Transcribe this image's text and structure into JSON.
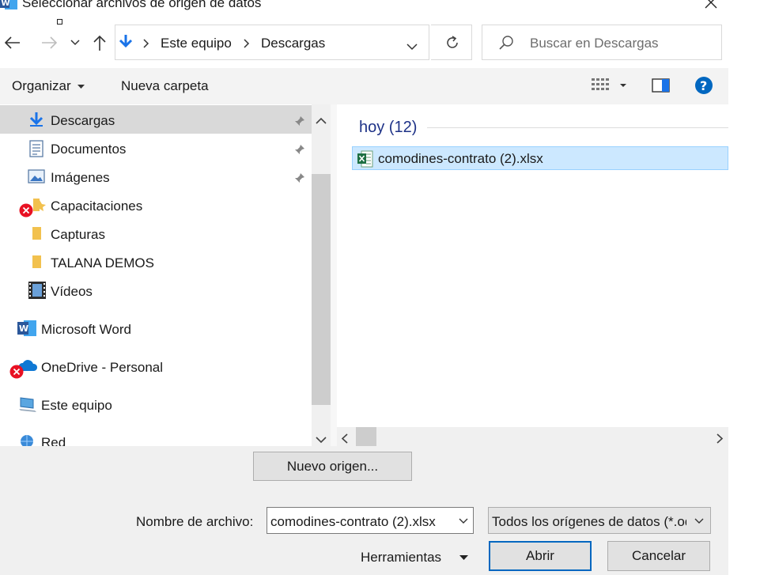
{
  "window": {
    "title": "Seleccionar archivos de origen de datos",
    "app_icon": "word-icon"
  },
  "nav": {
    "back_icon": "arrow-left-icon",
    "forward_icon": "arrow-right-icon",
    "recent_icon": "chevron-down-icon",
    "up_icon": "arrow-up-icon"
  },
  "address": {
    "breadcrumbs": [
      "Este equipo",
      "Descargas"
    ],
    "location_icon": "download-arrow-icon"
  },
  "search": {
    "placeholder": "Buscar en Descargas"
  },
  "toolbar": {
    "organize_label": "Organizar",
    "new_folder_label": "Nueva carpeta"
  },
  "sidebar": {
    "items": [
      {
        "label": "Descargas",
        "icon": "download-arrow-icon",
        "pinned": true,
        "selected": true
      },
      {
        "label": "Documentos",
        "icon": "document-icon",
        "pinned": true
      },
      {
        "label": "Imágenes",
        "icon": "pictures-icon",
        "pinned": true
      },
      {
        "label": "Capacitaciones",
        "icon": "folder-icon",
        "error": true
      },
      {
        "label": "Capturas",
        "icon": "folder-icon"
      },
      {
        "label": "TALANA DEMOS",
        "icon": "folder-icon"
      },
      {
        "label": "Vídeos",
        "icon": "video-icon"
      },
      {
        "label": "Microsoft Word",
        "icon": "word-icon"
      },
      {
        "label": "OneDrive - Personal",
        "icon": "cloud-icon",
        "error": true
      },
      {
        "label": "Este equipo",
        "icon": "computer-icon"
      },
      {
        "label": "Red",
        "icon": "network-icon"
      }
    ]
  },
  "content": {
    "group_header": "hoy (12)",
    "files": [
      {
        "name": "comodines-contrato (2).xlsx",
        "icon": "excel-file-icon",
        "selected": true
      }
    ]
  },
  "footer": {
    "new_source_label": "Nuevo origen...",
    "filename_label": "Nombre de archivo:",
    "filename_value": "comodines-contrato (2).xlsx",
    "filter_value": "Todos los orígenes de datos (*.odc;*.mdb;*.mde;*.accdb;*.accde;*.ole.dsn;*.udl;*.odc;*.dsn;*.xlsx)",
    "tools_label": "Herramientas",
    "open_label": "Abrir",
    "cancel_label": "Cancelar"
  },
  "colors": {
    "accent": "#0067c0",
    "selection": "#cce8ff",
    "group_header": "#1e3287",
    "excel_green": "#1d6f42",
    "word_blue": "#2b579a",
    "error_red": "#e81123"
  }
}
